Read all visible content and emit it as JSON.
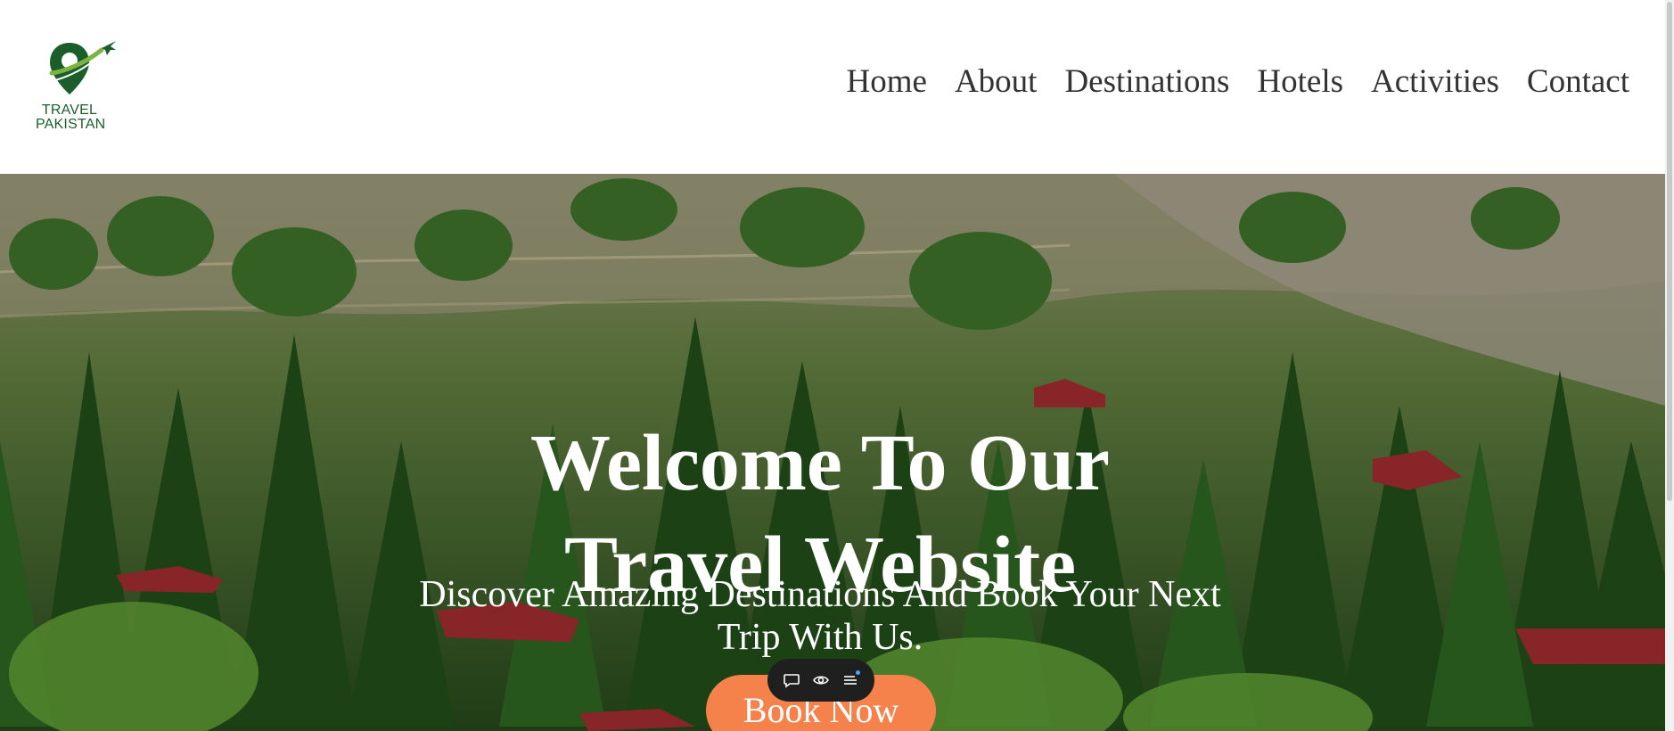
{
  "brand": {
    "line1": "TRAVEL",
    "line2": "PAKISTAN",
    "primary_color": "#1b5e2a",
    "accent_color": "#7cb342"
  },
  "nav": {
    "items": [
      "Home",
      "About",
      "Destinations",
      "Hotels",
      "Activities",
      "Contact"
    ]
  },
  "hero": {
    "title_line1": "Welcome To Our",
    "title_line2": "Travel Website",
    "subtitle_line1": "Discover Amazing Destinations And Book Your Next",
    "subtitle_line2": "Trip With Us.",
    "cta_label": "Book Now",
    "cta_color": "#f6824b"
  },
  "toolbar": {
    "icons": [
      "comment-icon",
      "eye-icon",
      "list-icon"
    ]
  }
}
